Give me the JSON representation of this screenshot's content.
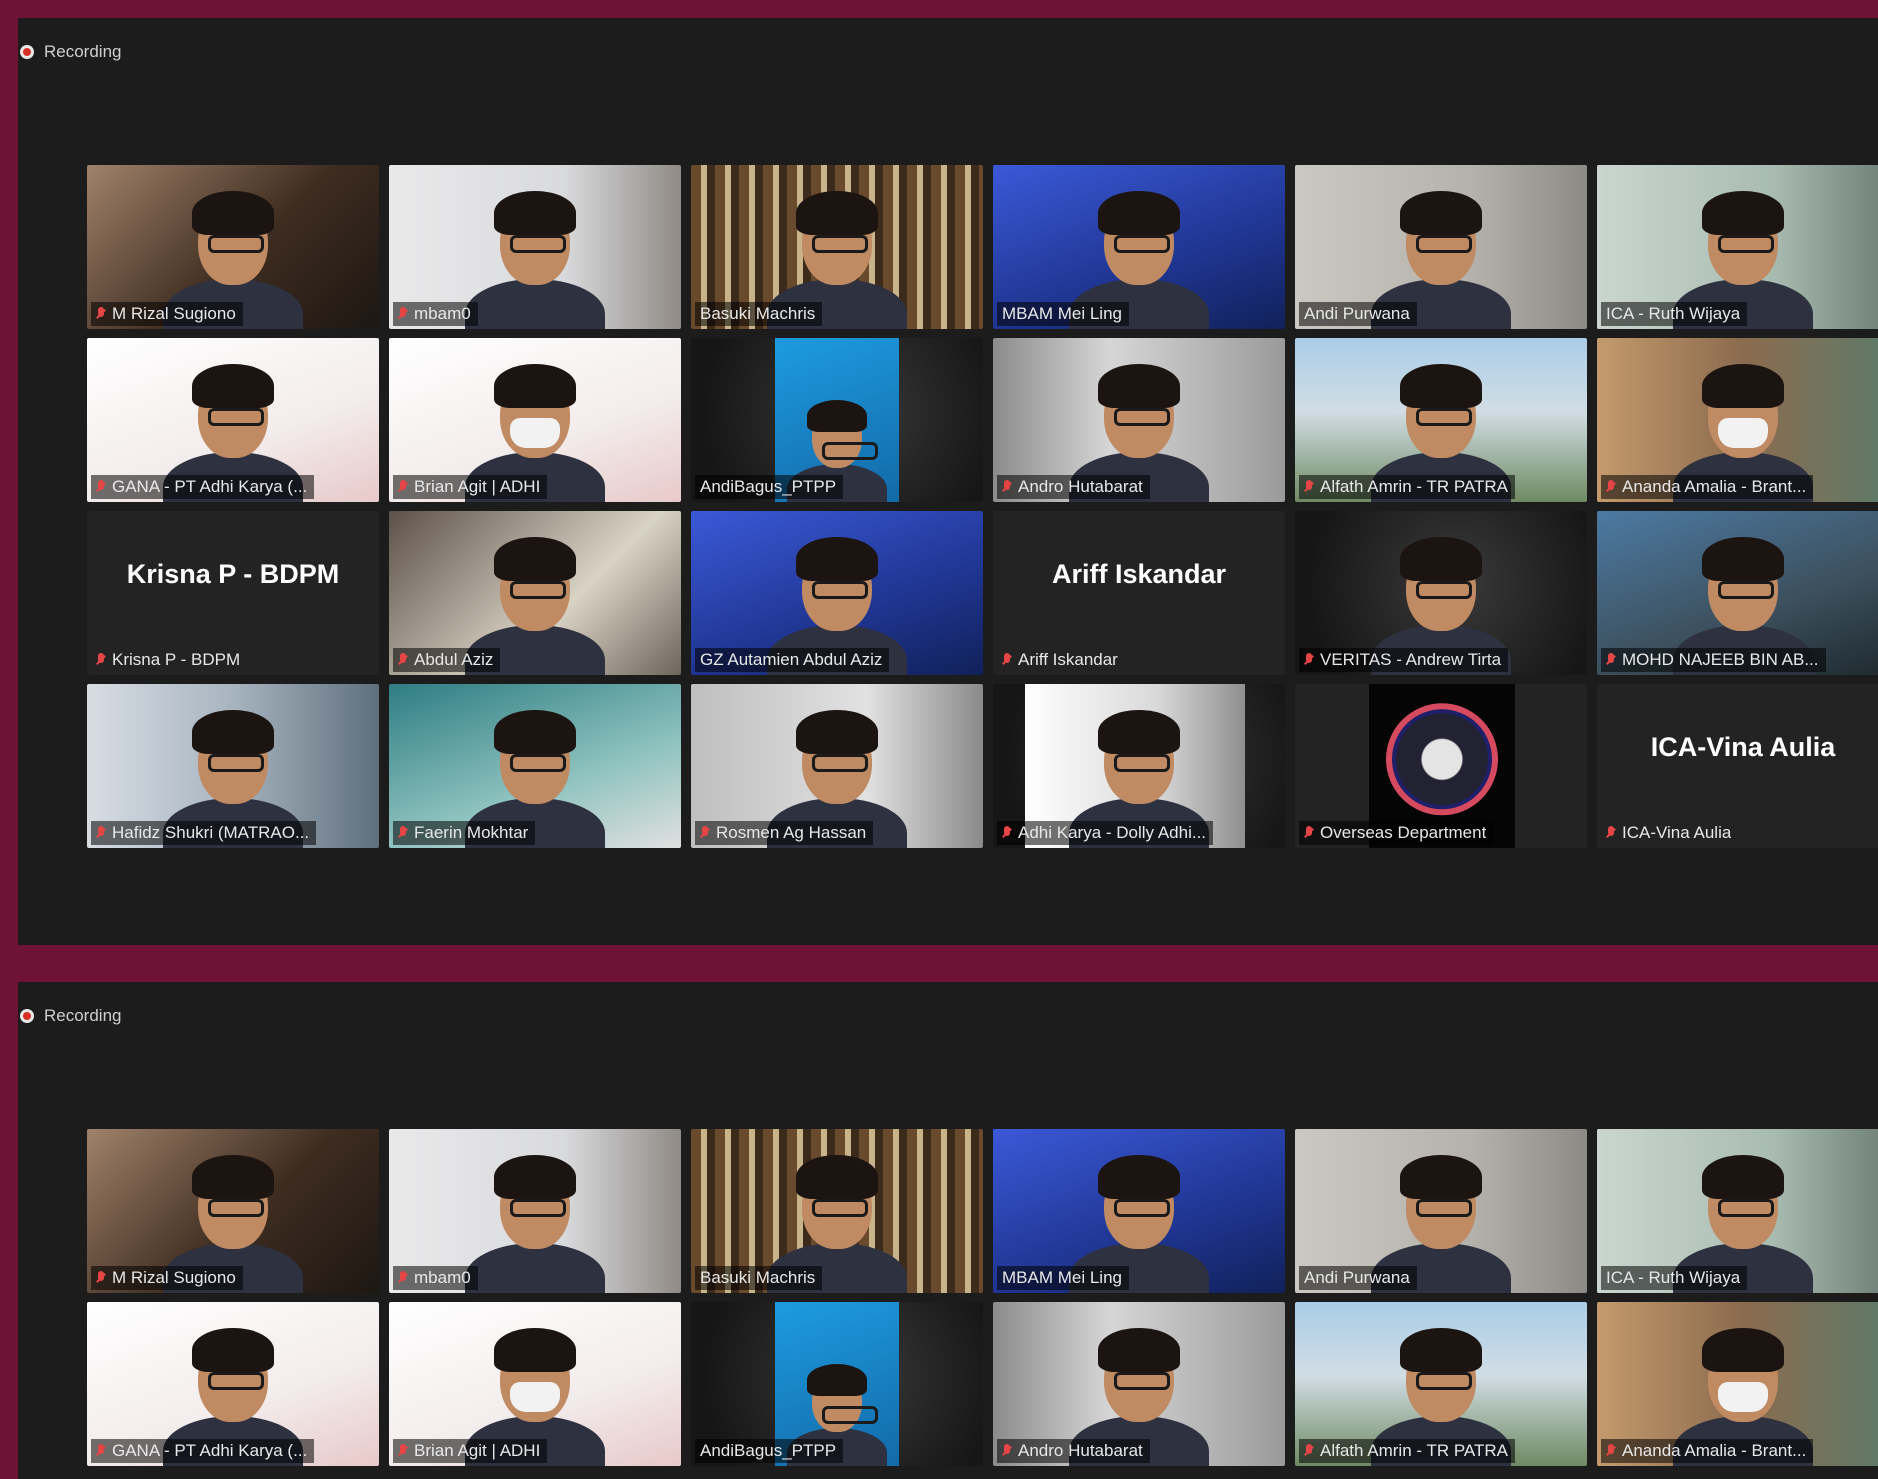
{
  "meetings": [
    {
      "recording_label": "Recording",
      "tiles": [
        {
          "name": "M Rizal Sugiono",
          "muted": true,
          "bg": "room",
          "avatar": true
        },
        {
          "name": "mbam0",
          "muted": true,
          "bg": "window",
          "avatar": true
        },
        {
          "name": "Basuki Machris",
          "muted": false,
          "bg": "books",
          "avatar": true
        },
        {
          "name": "MBAM Mei Ling",
          "muted": false,
          "bg": "city",
          "avatar": true
        },
        {
          "name": "Andi Purwana",
          "muted": false,
          "bg": "plain",
          "avatar": true
        },
        {
          "name": "ICA - Ruth Wijaya",
          "muted": false,
          "bg": "green",
          "avatar": true,
          "active": true
        },
        {
          "name": "GANA - PT Adhi Karya (...",
          "muted": true,
          "bg": "event",
          "avatar": true
        },
        {
          "name": "Brian Agit | ADHI",
          "muted": true,
          "bg": "event",
          "avatar": true,
          "mask": true
        },
        {
          "name": "AndiBagus_PTPP",
          "muted": false,
          "bg": "dark",
          "avatar": true,
          "inset": "blue-panel"
        },
        {
          "name": "Andro Hutabarat",
          "muted": true,
          "bg": "office",
          "avatar": true
        },
        {
          "name": "Alfath Amrin - TR PATRA",
          "muted": true,
          "bg": "sky",
          "avatar": true
        },
        {
          "name": "Ananda Amalia - Brant...",
          "muted": true,
          "bg": "wood",
          "avatar": true,
          "mask": true
        },
        {
          "name": "Krisna P - BDPM",
          "muted": true,
          "bg": "none",
          "avatar": false,
          "card": "Krisna P - BDPM"
        },
        {
          "name": "Abdul Aziz",
          "muted": true,
          "bg": "indoor",
          "avatar": true
        },
        {
          "name": "GZ Autamien Abdul Aziz",
          "muted": false,
          "bg": "city",
          "avatar": true
        },
        {
          "name": "Ariff Iskandar",
          "muted": true,
          "bg": "none",
          "avatar": false,
          "card": "Ariff Iskandar"
        },
        {
          "name": "VERITAS - Andrew Tirta",
          "muted": true,
          "bg": "dark",
          "avatar": true
        },
        {
          "name": "MOHD NAJEEB BIN AB...",
          "muted": true,
          "bg": "blur",
          "avatar": true
        },
        {
          "name": "Hafidz Shukri (MATRAO...",
          "muted": true,
          "bg": "building",
          "avatar": true
        },
        {
          "name": "Faerin Mokhtar",
          "muted": true,
          "bg": "teal",
          "avatar": true
        },
        {
          "name": "Rosmen Ag Hassan",
          "muted": true,
          "bg": "grey",
          "avatar": true
        },
        {
          "name": "Adhi Karya - Dolly Adhi...",
          "muted": true,
          "bg": "dark",
          "avatar": true,
          "inset": "photo-panel"
        },
        {
          "name": "Overseas Department",
          "muted": true,
          "bg": "none",
          "avatar": false,
          "inset": "globe-panel"
        },
        {
          "name": "ICA-Vina Aulia",
          "muted": true,
          "bg": "none",
          "avatar": false,
          "card": "ICA-Vina Aulia"
        }
      ]
    },
    {
      "recording_label": "Recording",
      "tiles": [
        {
          "name": "M Rizal Sugiono",
          "muted": true,
          "bg": "room",
          "avatar": true
        },
        {
          "name": "mbam0",
          "muted": true,
          "bg": "window",
          "avatar": true
        },
        {
          "name": "Basuki Machris",
          "muted": false,
          "bg": "books",
          "avatar": true
        },
        {
          "name": "MBAM Mei Ling",
          "muted": false,
          "bg": "city",
          "avatar": true
        },
        {
          "name": "Andi Purwana",
          "muted": false,
          "bg": "plain",
          "avatar": true
        },
        {
          "name": "ICA - Ruth Wijaya",
          "muted": false,
          "bg": "green",
          "avatar": true,
          "active": true
        },
        {
          "name": "GANA - PT Adhi Karya (...",
          "muted": true,
          "bg": "event",
          "avatar": true
        },
        {
          "name": "Brian Agit | ADHI",
          "muted": true,
          "bg": "event",
          "avatar": true,
          "mask": true
        },
        {
          "name": "AndiBagus_PTPP",
          "muted": false,
          "bg": "dark",
          "avatar": true,
          "inset": "blue-panel"
        },
        {
          "name": "Andro Hutabarat",
          "muted": true,
          "bg": "office",
          "avatar": true
        },
        {
          "name": "Alfath Amrin - TR PATRA",
          "muted": true,
          "bg": "sky",
          "avatar": true
        },
        {
          "name": "Ananda Amalia - Brant...",
          "muted": true,
          "bg": "wood",
          "avatar": true,
          "mask": true
        }
      ]
    }
  ],
  "colors": {
    "frame": "#6e1236",
    "window_bg": "#1c1c1c",
    "tile_bg": "#232323",
    "active_speaker_border": "#c9d64a",
    "muted_icon": "#e64545",
    "recording_dot": "#d93025"
  },
  "icons": {
    "recording": "recording-dot-icon",
    "muted": "mic-muted-icon"
  }
}
